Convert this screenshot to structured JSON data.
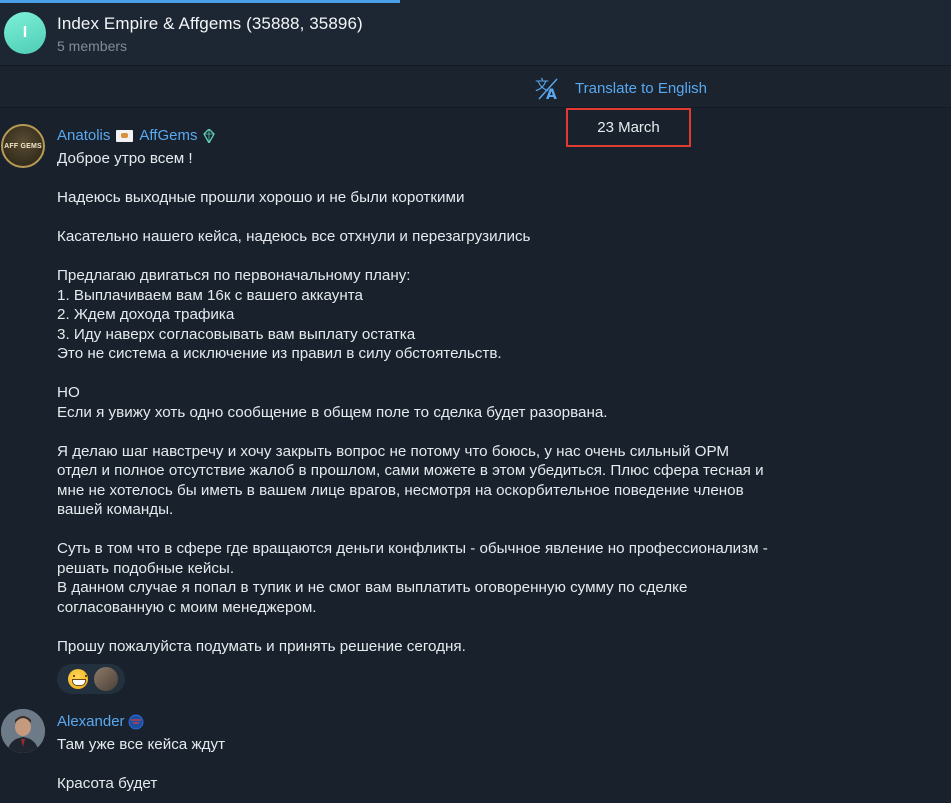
{
  "header": {
    "avatar_letter": "I",
    "title": "Index Empire & Affgems (35888, 35896)",
    "members": "5 members"
  },
  "translate": {
    "label": "Translate to English"
  },
  "date_divider": "23 March",
  "colors": {
    "accent": "#5aa9f0",
    "highlight_border": "#e03a33",
    "background": "#18212c"
  },
  "messages": [
    {
      "sender": "Anatolis",
      "sender_extra": "AffGems",
      "avatar_logo": "AFF GEMS",
      "text": "Доброе утро всем !\n\nНадеюсь выходные прошли хорошо и не были короткими\n\nКасательно нашего кейса, надеюсь все отхнули и перезагрузились\n\nПредлагаю двигаться по первоначальному плану:\n1. Выплачиваем вам 16к с вашего аккаунта\n2. Ждем дохода трафика\n3. Иду наверх согласовывать вам выплату остатка\nЭто не система а исключение из правил в силу обстоятельств.\n\nНО\nЕсли я увижу хоть одно сообщение в общем поле то сделка будет разорвана.\n\nЯ делаю шаг навстречу и хочу закрыть вопрос не потому что боюсь, у нас очень сильный ОРМ\nотдел и полное отсутствие жалоб в прошлом, сами можете в этом убедиться. Плюс сфера тесная и\nмне не хотелось бы иметь в вашем лице врагов, несмотря на оскорбительное поведение членов\nвашей команды.\n\nСуть в том что в сфере где вращаются деньги конфликты - обычное явление но профессионализм -\nрешать подобные кейсы.\nВ данном случае я попал в тупик и не смог вам выплатить оговоренную сумму по сделке\nсогласованную с моим менеджером.\n\nПрошу пожалуйста подумать и принять решение сегодня.",
      "reactions": [
        "grinning-face",
        "user-avatar"
      ]
    },
    {
      "sender": "Alexander",
      "text": "Там уже все кейса ждут\n\nКрасота будет"
    }
  ]
}
